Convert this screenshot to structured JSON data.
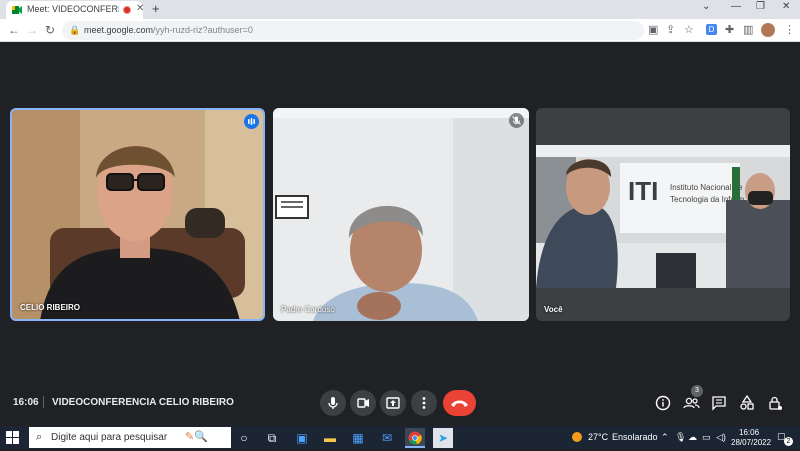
{
  "browser": {
    "tab_title": "Meet: VIDEOCONFERENCIA",
    "tab_close": "✕",
    "new_tab": "+",
    "url_host": "meet.google.com",
    "url_path": "/yyh-ruzd-riz?authuser=0",
    "window_controls": {
      "menu": "⌄",
      "minimize": "—",
      "maximize": "❐",
      "close": "✕"
    }
  },
  "participants": [
    {
      "name": "CELIO RIBEIRO",
      "active_speaker": true
    },
    {
      "name": "Padre Cardoso",
      "active_speaker": false
    },
    {
      "name": "Você",
      "active_speaker": false
    }
  ],
  "wall_sign": {
    "line1": "Instituto Nacional de",
    "line2": "Tecnologia da Inform"
  },
  "meeting": {
    "time": "16:06",
    "title": "VIDEOCONFERENCIA CELIO RIBEIRO",
    "people_count": "3"
  },
  "taskbar": {
    "search_placeholder": "Digite aqui para pesquisar",
    "weather_temp": "27°C",
    "weather_desc": "Ensolarado",
    "clock_time": "16:06",
    "clock_date": "28/07/2022",
    "notification_count": "2"
  },
  "colors": {
    "meet_bg": "#202124",
    "accent": "#8ab4f8",
    "hangup": "#ea4335",
    "taskbar": "#1b2533"
  }
}
